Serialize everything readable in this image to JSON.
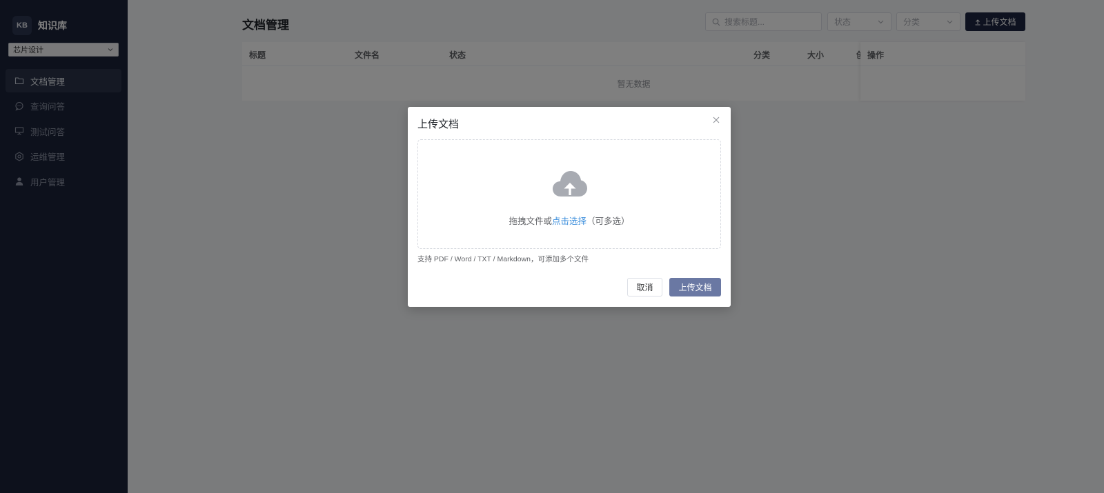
{
  "brand": {
    "badge": "KB",
    "name": "知识库"
  },
  "kb_selector": {
    "value": "芯片设计"
  },
  "sidebar": {
    "items": [
      {
        "label": "文档管理",
        "icon": "folder-icon",
        "active": true
      },
      {
        "label": "查询问答",
        "icon": "chat-icon",
        "active": false
      },
      {
        "label": "测试问答",
        "icon": "presentation-icon",
        "active": false
      },
      {
        "label": "运维管理",
        "icon": "gear-icon",
        "active": false
      },
      {
        "label": "用户管理",
        "icon": "user-icon",
        "active": false
      }
    ]
  },
  "page": {
    "title": "文档管理",
    "search_placeholder": "搜索标题...",
    "status_filter": "状态",
    "category_filter": "分类",
    "upload_button": "上传文档"
  },
  "table": {
    "columns": [
      "标题",
      "文件名",
      "状态",
      "分类",
      "大小",
      "创",
      "操作"
    ],
    "empty_text": "暂无数据"
  },
  "modal": {
    "title": "上传文档",
    "drop_text_before": "拖拽文件或",
    "drop_link": "点击选择",
    "drop_text_after": "（可多选）",
    "hint": "支持 PDF / Word / TXT / Markdown，可添加多个文件",
    "cancel": "取消",
    "confirm": "上传文档"
  },
  "colors": {
    "sidebar_bg": "#1b2338",
    "primary_dark": "#1d2540",
    "confirm_button": "#6a78a3",
    "link": "#3d8fdc"
  }
}
